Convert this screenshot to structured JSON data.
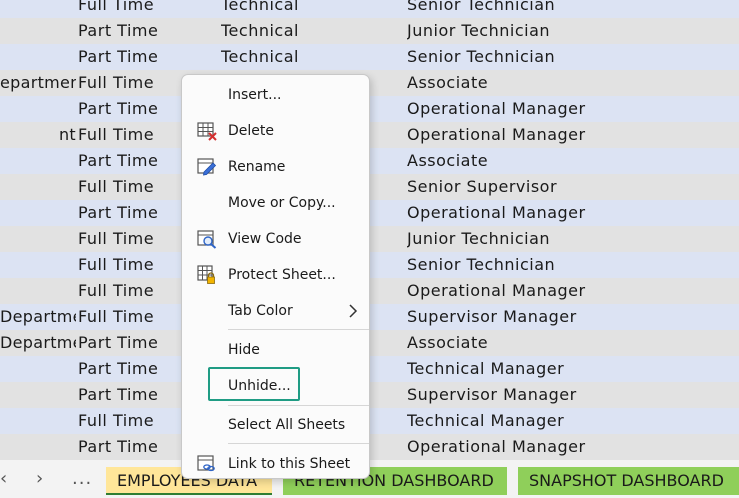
{
  "rows": [
    [
      "",
      "Full Time",
      "Technical",
      "Senior Technician"
    ],
    [
      "",
      "Part Time",
      "Technical",
      "Junior Technician"
    ],
    [
      "",
      "Part Time",
      "Technical",
      "Senior Technician"
    ],
    [
      "epartmen",
      "Full Time",
      "",
      "Associate"
    ],
    [
      "",
      "Part Time",
      "",
      "Operational Manager"
    ],
    [
      "nt",
      "Full Time",
      "",
      "Operational Manager"
    ],
    [
      "",
      "Part Time",
      "",
      "Associate"
    ],
    [
      "",
      "Full Time",
      "",
      "Senior Supervisor"
    ],
    [
      "",
      "Part Time",
      "",
      "Operational Manager"
    ],
    [
      "",
      "Full Time",
      "",
      "Junior Technician"
    ],
    [
      "",
      "Full Time",
      "",
      "Senior Technician"
    ],
    [
      "",
      "Full Time",
      "",
      "Operational Manager"
    ],
    [
      "Departme",
      "Full Time",
      "",
      "Supervisor Manager"
    ],
    [
      "Departme",
      "Part Time",
      "",
      "Associate"
    ],
    [
      "",
      "Part Time",
      "",
      "Technical Manager"
    ],
    [
      "",
      "Part Time",
      "",
      "Supervisor Manager"
    ],
    [
      "",
      "Full Time",
      "",
      "Technical Manager"
    ],
    [
      "",
      "Part Time",
      "",
      "Operational Manager"
    ]
  ],
  "context_menu": {
    "insert": "Insert...",
    "delete": "Delete",
    "rename": "Rename",
    "move_copy": "Move or Copy...",
    "view_code": "View Code",
    "protect_sheet": "Protect Sheet...",
    "tab_color": "Tab Color",
    "hide": "Hide",
    "unhide": "Unhide...",
    "select_all_sheets": "Select All Sheets",
    "link_to_sheet": "Link to this Sheet"
  },
  "tab_bar": {
    "prev_icon": "chevron-left-icon",
    "next_icon": "chevron-right-icon",
    "more": "...",
    "tabs": [
      "EMPLOYEES DATA",
      "RETENTION DASHBOARD",
      "SNAPSHOT DASHBOARD"
    ]
  },
  "colors": {
    "row_band_blue": "#dce3f3",
    "row_band_gray": "#e2e2e2",
    "active_tab": "#ffe699",
    "dashboard_tab": "#8fcf5a",
    "highlight_border": "#1f9c84"
  }
}
